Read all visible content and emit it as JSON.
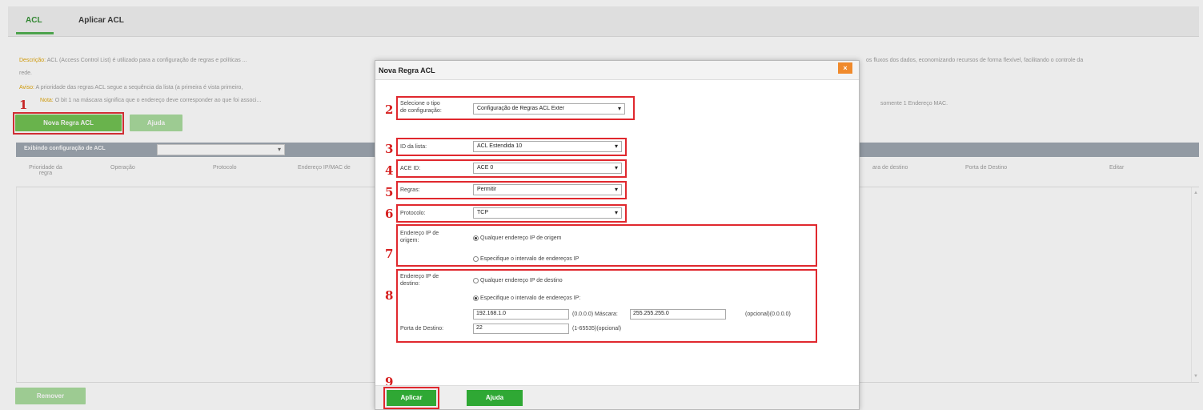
{
  "tabs": [
    {
      "label": "ACL"
    },
    {
      "label": "Aplicar ACL"
    }
  ],
  "description": {
    "line1_label": "Descrição:",
    "line1_text": "ACL (Access Control List) é utilizado para a configuração de regras e políticas ...",
    "line1_right": "os fluxos dos dados, economizando recursos de forma flexível, facilitando o controle da",
    "line1_cont": "rede.",
    "line2_label": "Aviso:",
    "line2_text": "A prioridade das regras ACL segue a sequência da lista (a primeira é vista primeiro,",
    "line3_label": "Nota:",
    "line3_text": "O bit 1 na máscara significa que o endereço deve corresponder ao que foi associ...",
    "line3_right": "somente 1 Endereço MAC."
  },
  "buttons": {
    "new_rule": "Nova Regra ACL",
    "help": "Ajuda",
    "remove": "Remover"
  },
  "filter": {
    "label": "Exibindo configuração de ACL",
    "value": ""
  },
  "table": {
    "headers": [
      "Prioridade da regra",
      "Operação",
      "Protocolo",
      "Endereço IP/MAC de",
      "ara de destino",
      "Porta de Destino",
      "Editar"
    ]
  },
  "annotations": [
    "1",
    "2",
    "3",
    "4",
    "5",
    "6",
    "7",
    "8",
    "9"
  ],
  "modal": {
    "title": "Nova Regra ACL",
    "close": "×",
    "config_type_label": "Selecione o tipo de configuração:",
    "config_type_value": "Configuração de Regras ACL Exter",
    "list_id_label": "ID da lista:",
    "list_id_value": "ACL Estendida 10",
    "ace_id_label": "ACE ID:",
    "ace_id_value": "ACE 0",
    "rules_label": "Regras:",
    "rules_value": "Permitir",
    "protocol_label": "Protocolo:",
    "protocol_value": "TCP",
    "src_label": "Endereço IP de origem:",
    "src_any": "Qualquer endereço IP de origem",
    "src_range": "Especifique o intervalo de endereços IP",
    "dst_label": "Endereço IP de destino:",
    "dst_any": "Qualquer endereço IP de destino",
    "dst_range": "Especifique o intervalo de endereços IP:",
    "dst_ip": "192.168.1.0",
    "dst_ip_hint": "(0.0.0.0) Máscara:",
    "dst_mask": "255.255.255.0",
    "dst_mask_hint": "(opcional)(0.0.0.0)",
    "dst_port_label": "Porta de Destino:",
    "dst_port": "22",
    "dst_port_hint": "(1-65535)(opcional)",
    "apply": "Aplicar",
    "help": "Ajuda"
  },
  "colors": {
    "accent": "#4cae4c",
    "annotation": "#e0282e",
    "close": "#f08a2c"
  }
}
